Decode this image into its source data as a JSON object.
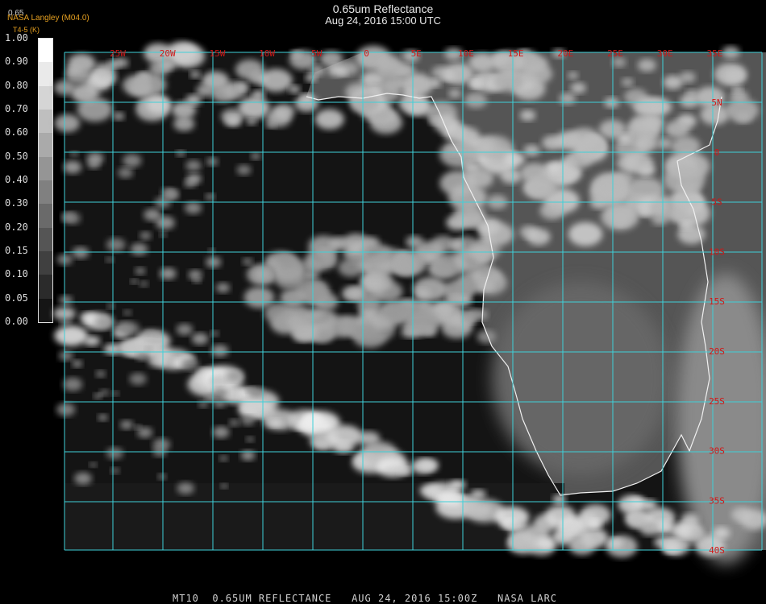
{
  "header": {
    "title": "0.65um Reflectance",
    "subtitle": "Aug 24, 2016 15:00 UTC",
    "credit": "NASA Langley (M04.0)",
    "units": "T4-5 (K)",
    "colorbar_max_label": "0.65"
  },
  "colorbar": {
    "ticks": [
      "1.00",
      "0.90",
      "0.80",
      "0.70",
      "0.60",
      "0.50",
      "0.40",
      "0.30",
      "0.20",
      "0.15",
      "0.10",
      "0.05",
      "0.00"
    ]
  },
  "grid": {
    "lon_labels": [
      "25W",
      "20W",
      "15W",
      "10W",
      "5W",
      "0",
      "5E",
      "10E",
      "15E",
      "20E",
      "25E",
      "30E",
      "35E"
    ],
    "lat_labels": [
      "5N",
      "0",
      "5S",
      "10S",
      "15S",
      "20S",
      "25S",
      "30S",
      "35S",
      "40S"
    ],
    "line_color": "#3fd0d8",
    "label_color": "#d01818"
  },
  "footer": {
    "text": "MT10  0.65UM REFLECTANCE   AUG 24, 2016 15:00Z   NASA LARC"
  }
}
